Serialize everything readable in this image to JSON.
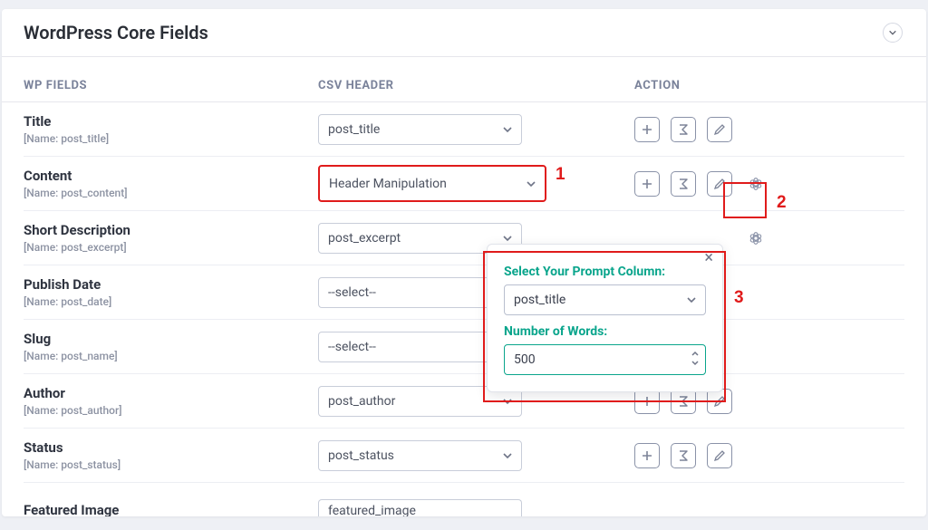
{
  "panel": {
    "title": "WordPress Core Fields"
  },
  "columns": {
    "c1": "WP FIELDS",
    "c2": "CSV HEADER",
    "c3": "ACTION"
  },
  "rows": [
    {
      "label": "Title",
      "name": "[Name: post_title]",
      "csv": "post_title",
      "ai": false,
      "highlight": false
    },
    {
      "label": "Content",
      "name": "[Name: post_content]",
      "csv": "Header Manipulation",
      "ai": true,
      "highlight": true
    },
    {
      "label": "Short Description",
      "name": "[Name: post_excerpt]",
      "csv": "post_excerpt",
      "ai": true,
      "highlight": false
    },
    {
      "label": "Publish Date",
      "name": "[Name: post_date]",
      "csv": "--select--",
      "ai": false,
      "highlight": false
    },
    {
      "label": "Slug",
      "name": "[Name: post_name]",
      "csv": "--select--",
      "ai": false,
      "highlight": false
    },
    {
      "label": "Author",
      "name": "[Name: post_author]",
      "csv": "post_author",
      "ai": false,
      "highlight": false
    },
    {
      "label": "Status",
      "name": "[Name: post_status]",
      "csv": "post_status",
      "ai": false,
      "highlight": false
    },
    {
      "label": "Featured Image",
      "name": "",
      "csv": "featured_image",
      "ai": false,
      "highlight": false
    }
  ],
  "popover": {
    "prompt_label": "Select Your Prompt Column:",
    "prompt_value": "post_title",
    "words_label": "Number of Words:",
    "words_value": "500"
  },
  "callouts": {
    "n1": "1",
    "n2": "2",
    "n3": "3"
  },
  "icons": {
    "add": "add-icon",
    "formula": "formula-icon",
    "edit": "edit-icon",
    "ai": "ai-icon",
    "chevron": "chevron-down-icon",
    "close": "close-icon"
  }
}
